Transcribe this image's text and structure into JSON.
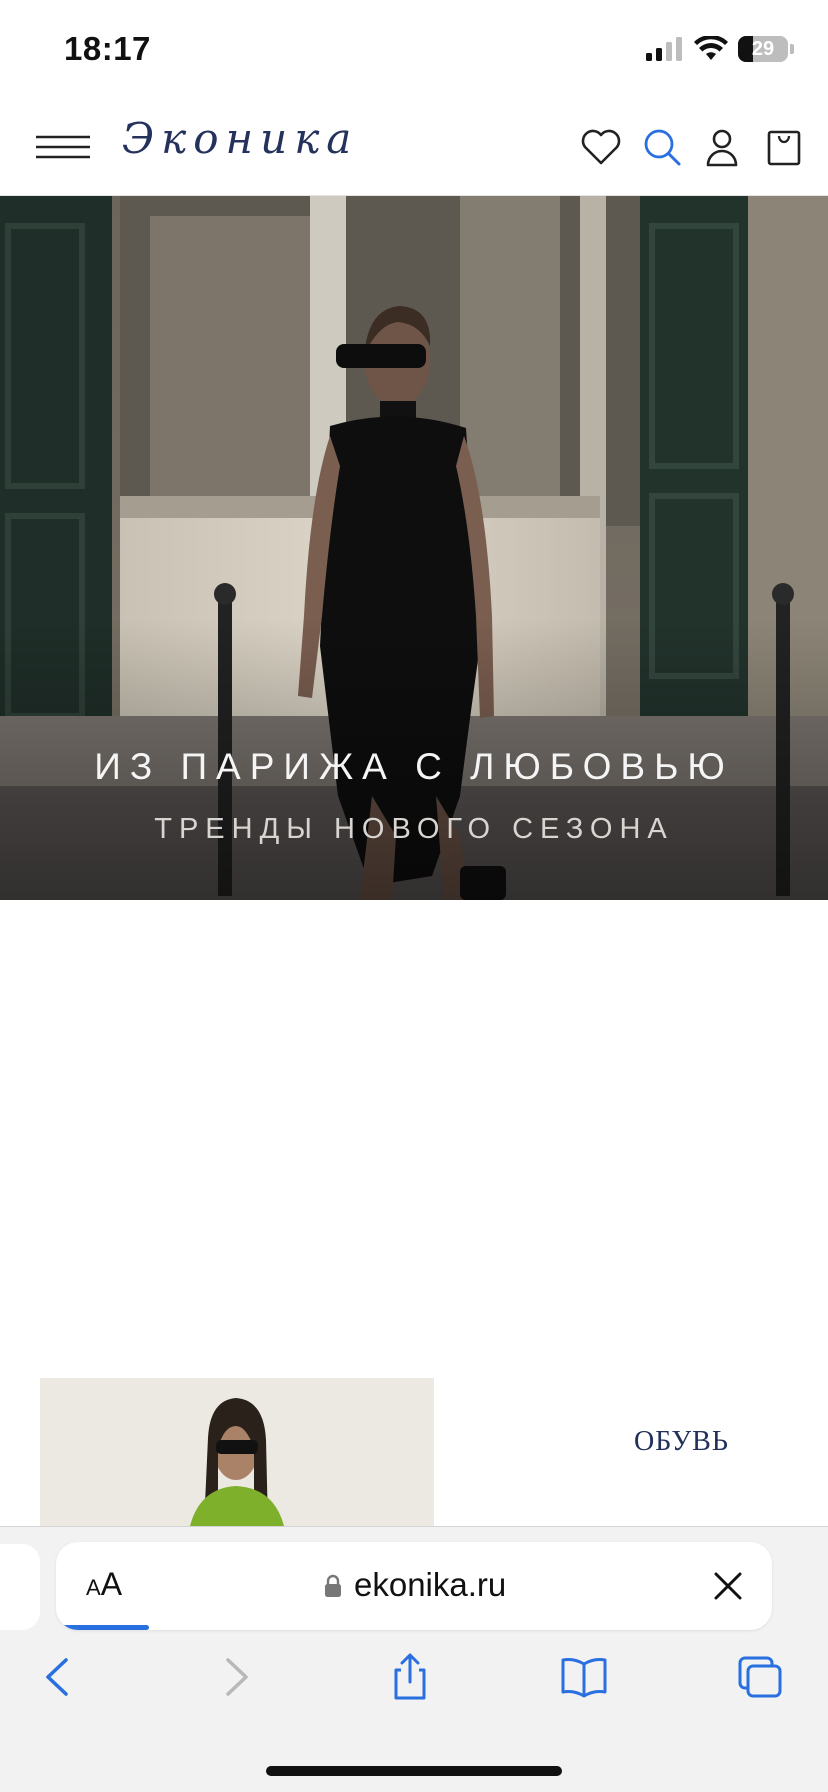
{
  "status_bar": {
    "time": "18:17",
    "battery_label": "29",
    "battery_level": 0.29
  },
  "header": {
    "logo_text": "Эконика",
    "icons": [
      "menu-icon",
      "heart-icon",
      "search-icon",
      "user-icon",
      "bag-icon"
    ],
    "accent_color": "#2a6fe0",
    "brand_color": "#24325c"
  },
  "hero": {
    "title": "ИЗ ПАРИЖА С ЛЮБОВЬЮ",
    "subtitle": "ТРЕНДЫ НОВОГО СЕЗОНА"
  },
  "category": {
    "label": "ОБУВЬ"
  },
  "browser": {
    "text_size_label": "AA",
    "url": "ekonika.ru",
    "load_progress": 0.13,
    "toolbar_icons": [
      "back-icon",
      "forward-icon",
      "share-icon",
      "bookmarks-icon",
      "tabs-icon"
    ]
  }
}
